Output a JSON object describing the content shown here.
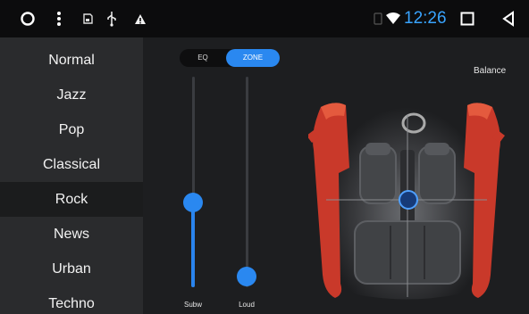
{
  "statusbar": {
    "time": "12:26",
    "icons": [
      "circle-icon",
      "dots-menu-icon",
      "sd-card-icon",
      "usb-icon",
      "warning-icon",
      "signal-icon",
      "wifi-icon",
      "recent-apps-icon",
      "back-icon"
    ]
  },
  "presets": [
    {
      "label": "Normal"
    },
    {
      "label": "Jazz"
    },
    {
      "label": "Pop"
    },
    {
      "label": "Classical"
    },
    {
      "label": "Rock"
    },
    {
      "label": "News"
    },
    {
      "label": "Urban"
    },
    {
      "label": "Techno"
    }
  ],
  "selected_preset": "Rock",
  "tabs": {
    "eq": "EQ",
    "zone": "ZONE",
    "active": "ZONE"
  },
  "sliders": [
    {
      "label": "Subw",
      "level": 0.4
    },
    {
      "label": "Loud",
      "level": 0.0
    }
  ],
  "balance": {
    "label": "Balance"
  },
  "colors": {
    "accent": "#2a88f0",
    "clock": "#39a4ff",
    "car_body": "#d43a2a"
  }
}
